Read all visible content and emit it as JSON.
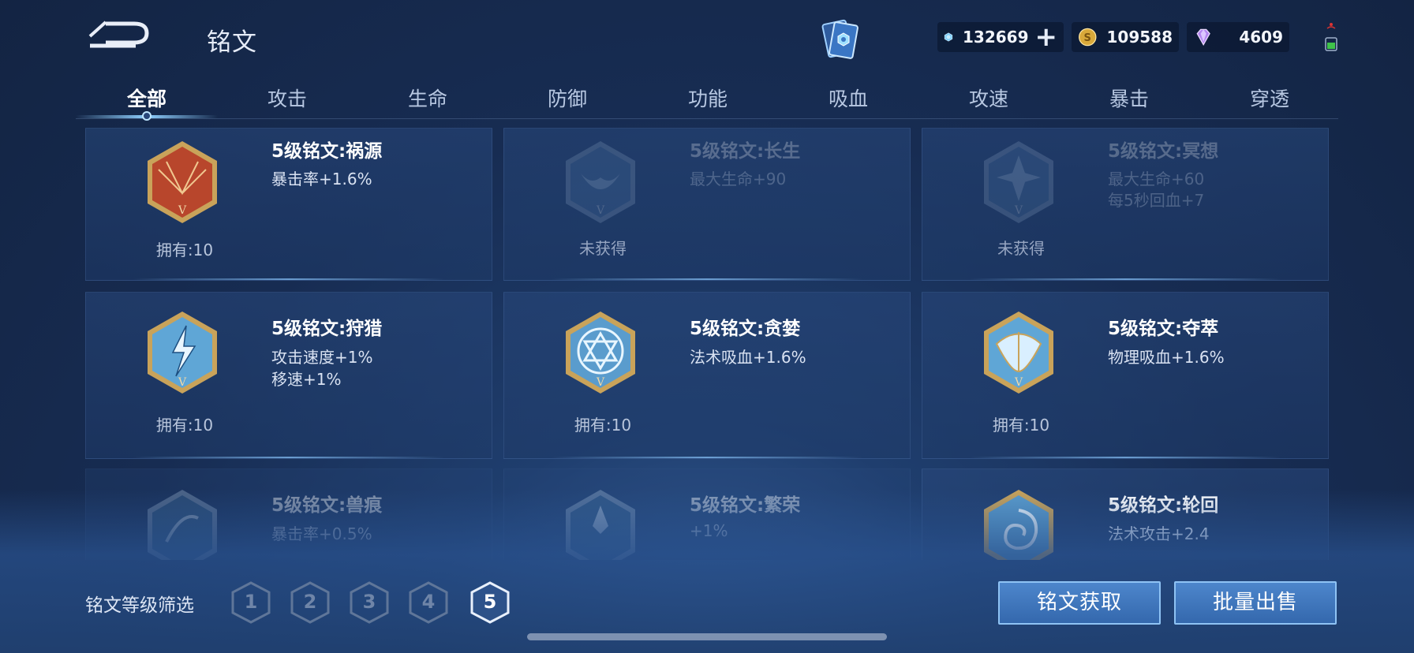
{
  "header": {
    "title": "铭文",
    "currencies": [
      {
        "name": "diamond",
        "value": "132669"
      },
      {
        "name": "coin",
        "value": "109588"
      },
      {
        "name": "gem",
        "value": "4609"
      }
    ]
  },
  "tabs": [
    "全部",
    "攻击",
    "生命",
    "防御",
    "功能",
    "吸血",
    "攻速",
    "暴击",
    "穿透"
  ],
  "runes": [
    {
      "name": "5级铭文:祸源",
      "stats": [
        "暴击率+1.6%"
      ],
      "owned": "拥有:10",
      "color": "#b8462c"
    },
    {
      "name": "5级铭文:长生",
      "stats": [
        "最大生命+90"
      ],
      "owned": "未获得",
      "color": "#4d78a8"
    },
    {
      "name": "5级铭文:冥想",
      "stats": [
        "最大生命+60",
        "每5秒回血+7"
      ],
      "owned": "未获得",
      "color": "#4d78a8"
    },
    {
      "name": "5级铭文:狩猎",
      "stats": [
        "攻击速度+1%",
        "移速+1%"
      ],
      "owned": "拥有:10",
      "color": "#5fa6d6"
    },
    {
      "name": "5级铭文:贪婪",
      "stats": [
        "法术吸血+1.6%"
      ],
      "owned": "拥有:10",
      "color": "#5a9ccd"
    },
    {
      "name": "5级铭文:夺萃",
      "stats": [
        "物理吸血+1.6%"
      ],
      "owned": "拥有:10",
      "color": "#5fa6d6"
    },
    {
      "name": "5级铭文:兽痕",
      "stats": [
        "暴击率+0.5%"
      ],
      "owned": "",
      "color": "#3e6b98"
    },
    {
      "name": "5级铭文:繁荣",
      "stats": [
        "+1%"
      ],
      "owned": "",
      "color": "#3e6b98"
    },
    {
      "name": "5级铭文:轮回",
      "stats": [
        "法术攻击+2.4"
      ],
      "owned": "",
      "color": "#5a9ccd"
    }
  ],
  "footer": {
    "filter_label": "铭文等级筛选",
    "levels": [
      "1",
      "2",
      "3",
      "4",
      "5"
    ],
    "active_level": "5",
    "obtain_label": "铭文获取",
    "sell_label": "批量出售"
  },
  "colors": {
    "accent": "#8fc3f4",
    "button": "#3e74ba",
    "gold_frame": "#c9a35a"
  }
}
